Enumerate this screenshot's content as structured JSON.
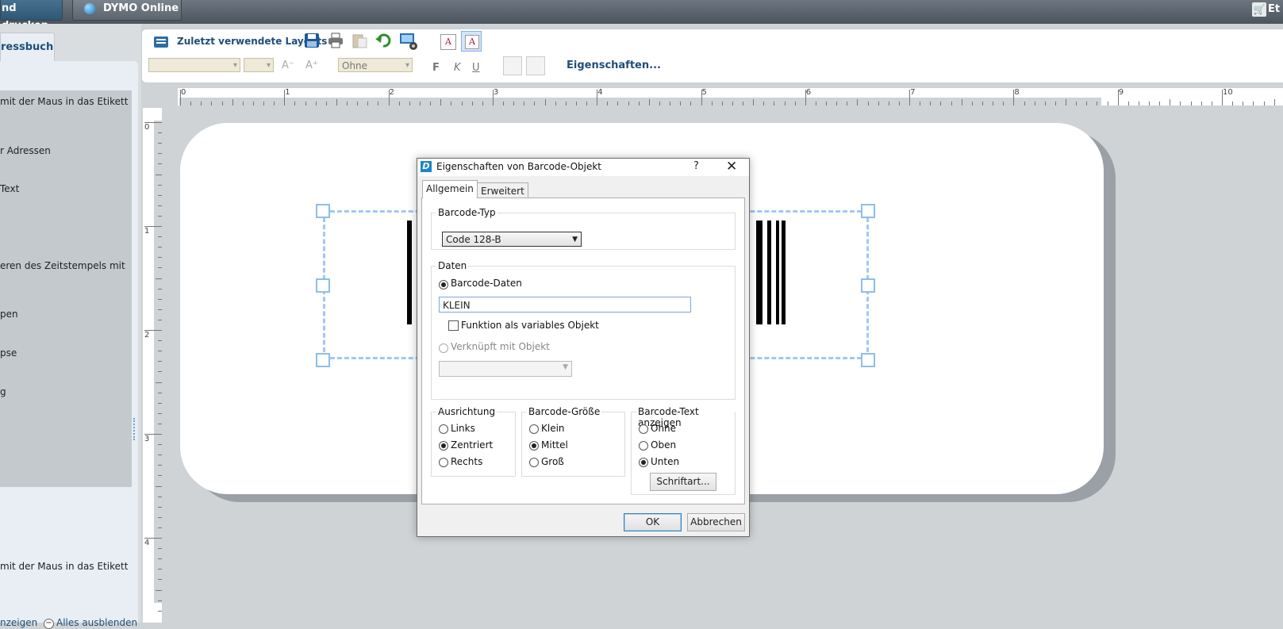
{
  "topbar": {
    "print_label": "nd drucken",
    "dymo_label": "DYMO Online",
    "right_label": "Et"
  },
  "left": {
    "tab_label": "ressbuch",
    "texts": [
      "mit der Maus in das Etikett",
      "r Adressen",
      "Text",
      "eren des Zeitstempels mit",
      "pen",
      "pse",
      "g",
      "mit der Maus in das Etikett"
    ],
    "show_all": "nzeigen",
    "hide_all": "Alles ausblenden"
  },
  "toolbar": {
    "recent_layouts": "Zuletzt verwendete Layouts",
    "border_dropdown": "Ohne",
    "bold": "F",
    "italic": "K",
    "underline": "U",
    "properties": "Eigenschaften..."
  },
  "ruler": {
    "h_numbers": [
      "0",
      "1",
      "2",
      "3",
      "4",
      "5",
      "6",
      "7",
      "8",
      "9",
      "10"
    ],
    "v_numbers": [
      "0",
      "1",
      "2",
      "3",
      "4"
    ]
  },
  "dialog": {
    "title": "Eigenschaften von Barcode-Objekt",
    "help": "?",
    "close": "✕",
    "tab_general": "Allgemein",
    "tab_advanced": "Erweitert",
    "type_group": "Barcode-Typ",
    "type_value": "Code 128-B",
    "data_group": "Daten",
    "barcode_data_label": "Barcode-Daten",
    "barcode_data_value": "KLEIN",
    "variable_label": "Funktion als variables Objekt",
    "linked_label": "Verknüpft mit Objekt",
    "align_group": "Ausrichtung",
    "align_options": [
      "Links",
      "Zentriert",
      "Rechts"
    ],
    "align_selected": "Zentriert",
    "size_group": "Barcode-Größe",
    "size_options": [
      "Klein",
      "Mittel",
      "Groß"
    ],
    "size_selected": "Mittel",
    "text_group": "Barcode-Text anzeigen",
    "text_options": [
      "Ohne",
      "Oben",
      "Unten"
    ],
    "text_selected": "Unten",
    "font_button": "Schriftart...",
    "ok": "OK",
    "cancel": "Abbrechen"
  }
}
